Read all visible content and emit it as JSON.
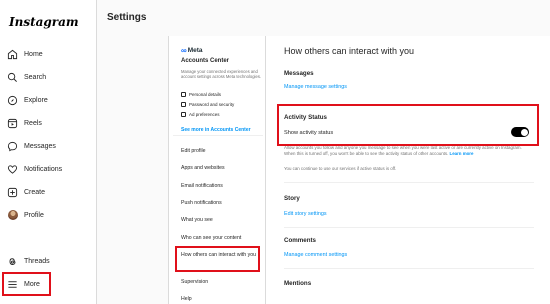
{
  "app": {
    "logo_text": "Instagram"
  },
  "nav": {
    "items": [
      {
        "label": "Home",
        "icon": "home-icon"
      },
      {
        "label": "Search",
        "icon": "search-icon"
      },
      {
        "label": "Explore",
        "icon": "compass-icon"
      },
      {
        "label": "Reels",
        "icon": "reels-icon"
      },
      {
        "label": "Messages",
        "icon": "messenger-icon"
      },
      {
        "label": "Notifications",
        "icon": "heart-icon"
      },
      {
        "label": "Create",
        "icon": "plus-square-icon"
      },
      {
        "label": "Profile",
        "icon": "avatar"
      }
    ],
    "threads_label": "Threads",
    "more_label": "More"
  },
  "page": {
    "title": "Settings"
  },
  "accounts_center": {
    "brand": "Meta",
    "title": "Accounts Center",
    "description": "Manage your connected experiences and account settings across Meta technologies.",
    "subitems": [
      "Personal details",
      "Password and security",
      "Ad preferences"
    ],
    "link": "See more in Accounts Center"
  },
  "settings_menu": {
    "items": [
      "Edit profile",
      "Apps and websites",
      "Email notifications",
      "Push notifications",
      "What you see",
      "Who can see your content",
      "How others can interact with you",
      "Supervision",
      "Help"
    ],
    "selected": "How others can interact with you"
  },
  "main": {
    "title": "How others can interact with you",
    "messages": {
      "heading": "Messages",
      "link": "Manage message settings"
    },
    "activity": {
      "heading": "Activity Status",
      "toggle_label": "Show activity status",
      "toggle_on": true,
      "description": "Allow accounts you follow and anyone you message to see when you were last active or are currently active on Instagram. When this is turned off, you won't be able to see the activity status of other accounts.",
      "learn_more": "Learn more",
      "note": "You can continue to use our services if active status is off."
    },
    "story": {
      "heading": "Story",
      "link": "Edit story settings"
    },
    "comments": {
      "heading": "Comments",
      "link": "Manage comment settings"
    },
    "mentions": {
      "heading": "Mentions"
    }
  },
  "colors": {
    "accent": "#0095f6",
    "highlight": "#e0101a",
    "toggle": "#000000"
  }
}
